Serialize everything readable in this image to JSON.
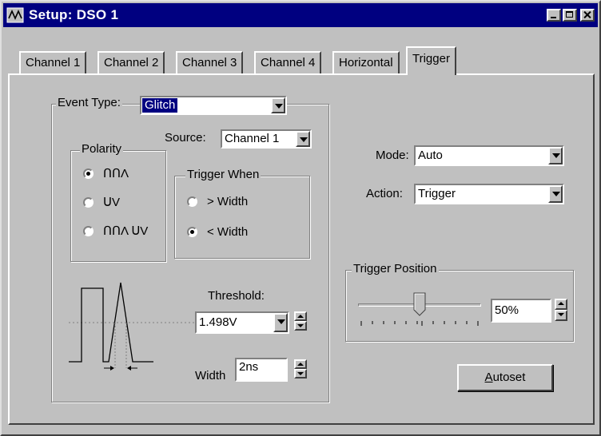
{
  "window": {
    "title": "Setup: DSO 1"
  },
  "tabs": [
    {
      "label": "Channel 1"
    },
    {
      "label": "Channel 2"
    },
    {
      "label": "Channel 3"
    },
    {
      "label": "Channel 4"
    },
    {
      "label": "Horizontal"
    },
    {
      "label": "Trigger",
      "active": true
    }
  ],
  "event_type": {
    "label": "Event Type:",
    "value": "Glitch"
  },
  "polarity": {
    "label": "Polarity",
    "options": [
      {
        "glyph": "ՈՈΛ",
        "icon": "positive-pulse-icon",
        "selected": true
      },
      {
        "glyph": "ՍV",
        "icon": "negative-pulse-icon",
        "selected": false
      },
      {
        "glyph": "ՈՈΛ ՍV",
        "icon": "either-pulse-icon",
        "selected": false
      }
    ]
  },
  "source": {
    "label": "Source:",
    "value": "Channel 1"
  },
  "trigger_when": {
    "label": "Trigger When",
    "options": [
      {
        "label": "> Width",
        "selected": false
      },
      {
        "label": "< Width",
        "selected": true
      }
    ]
  },
  "threshold": {
    "label": "Threshold:",
    "value": "1.498V"
  },
  "width": {
    "label": "Width",
    "value": "2ns"
  },
  "mode": {
    "label": "Mode:",
    "value": "Auto"
  },
  "action": {
    "label": "Action:",
    "value": "Trigger"
  },
  "trigger_position": {
    "label": "Trigger Position",
    "value": "50%",
    "slider_fraction": 0.5
  },
  "autoset": {
    "label": "Autoset",
    "mnemonic": "A"
  },
  "colors": {
    "title_bar": "#000080",
    "face": "#c0c0c0",
    "selection": "#000080"
  }
}
